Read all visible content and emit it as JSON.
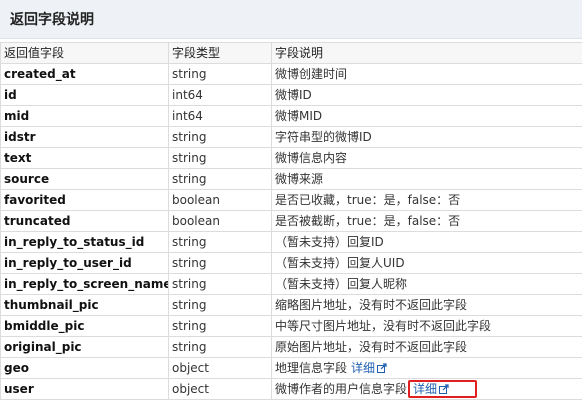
{
  "section": {
    "title": "返回字段说明"
  },
  "columns": [
    "返回值字段",
    "字段类型",
    "字段说明"
  ],
  "rows": [
    {
      "name": "created_at",
      "type": "string",
      "desc": "微博创建时间"
    },
    {
      "name": "id",
      "type": "int64",
      "desc": "微博ID"
    },
    {
      "name": "mid",
      "type": "int64",
      "desc": "微博MID"
    },
    {
      "name": "idstr",
      "type": "string",
      "desc": "字符串型的微博ID"
    },
    {
      "name": "text",
      "type": "string",
      "desc": "微博信息内容"
    },
    {
      "name": "source",
      "type": "string",
      "desc": "微博来源"
    },
    {
      "name": "favorited",
      "type": "boolean",
      "desc": "是否已收藏，true：是，false：否"
    },
    {
      "name": "truncated",
      "type": "boolean",
      "desc": "是否被截断，true：是，false：否"
    },
    {
      "name": "in_reply_to_status_id",
      "type": "string",
      "desc": "（暂未支持）回复ID"
    },
    {
      "name": "in_reply_to_user_id",
      "type": "string",
      "desc": "（暂未支持）回复人UID"
    },
    {
      "name": "in_reply_to_screen_name",
      "type": "string",
      "desc": "（暂未支持）回复人昵称"
    },
    {
      "name": "thumbnail_pic",
      "type": "string",
      "desc": "缩略图片地址，没有时不返回此字段"
    },
    {
      "name": "bmiddle_pic",
      "type": "string",
      "desc": "中等尺寸图片地址，没有时不返回此字段"
    },
    {
      "name": "original_pic",
      "type": "string",
      "desc": "原始图片地址，没有时不返回此字段"
    },
    {
      "name": "geo",
      "type": "object",
      "desc": "地理信息字段",
      "link": "详细",
      "icon": "external-link-icon"
    },
    {
      "name": "user",
      "type": "object",
      "desc": "微博作者的用户信息字段",
      "link": "详细",
      "icon": "external-link-icon",
      "highlighted": true
    }
  ],
  "colors": {
    "header_bg": "#eef2f7",
    "link": "#2060b0",
    "highlight_border": "#e02020"
  }
}
